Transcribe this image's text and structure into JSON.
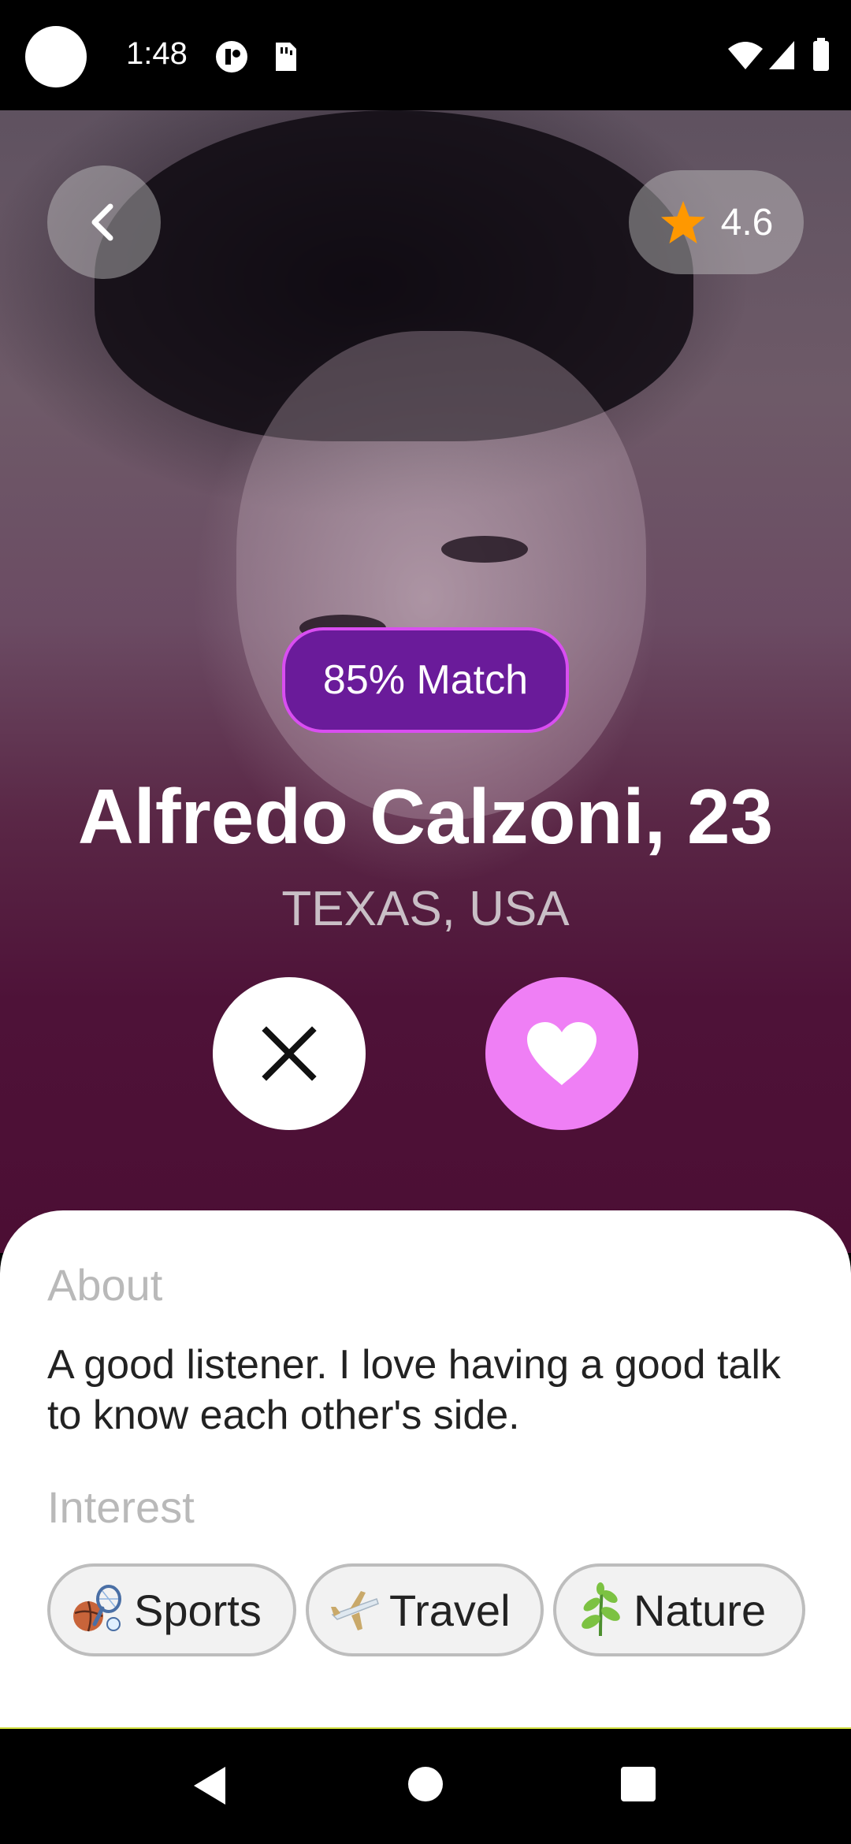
{
  "status_bar": {
    "time": "1:48"
  },
  "profile": {
    "rating": "4.6",
    "match_label": "85% Match",
    "name_age": "Alfredo Calzoni, 23",
    "location": "TEXAS, USA"
  },
  "about": {
    "heading": "About",
    "text": "A good listener. I love having a good talk to know each other's side."
  },
  "interests": {
    "heading": "Interest",
    "items": [
      {
        "label": "Sports",
        "icon": "sports-icon"
      },
      {
        "label": "Travel",
        "icon": "airplane-icon"
      },
      {
        "label": "Nature",
        "icon": "plant-icon"
      }
    ]
  },
  "colors": {
    "match_bg": "#6a1b9a",
    "match_border": "#d94ef1",
    "like_button": "#ef7ff5",
    "star": "#ff9800"
  }
}
